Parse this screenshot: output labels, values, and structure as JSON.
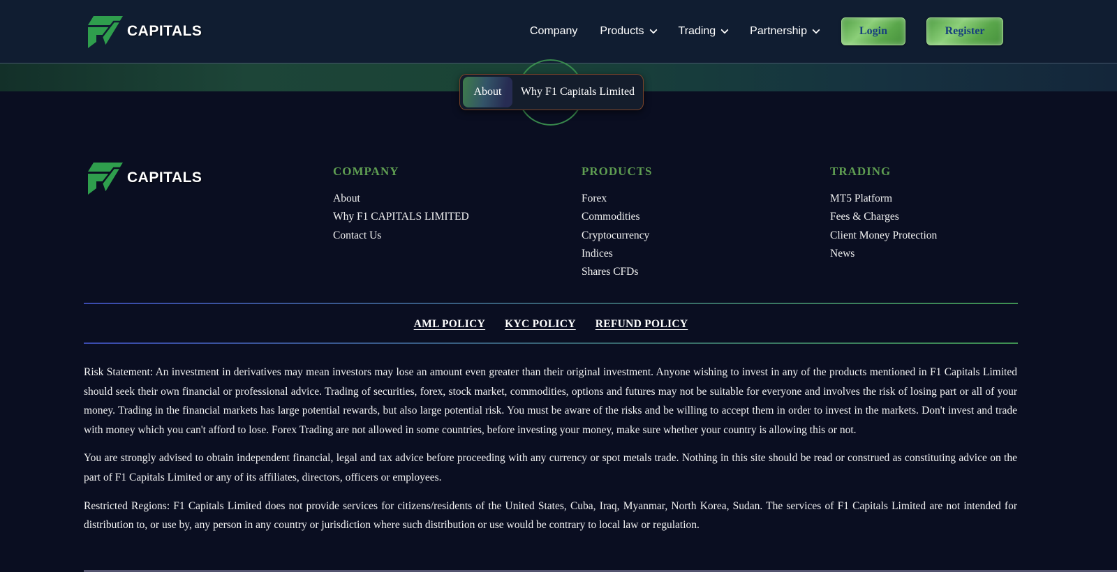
{
  "brand": {
    "name": "CAPITALS"
  },
  "header": {
    "nav": [
      {
        "label": "Company",
        "has_dropdown": false
      },
      {
        "label": "Products",
        "has_dropdown": true
      },
      {
        "label": "Trading",
        "has_dropdown": true
      },
      {
        "label": "Partnership",
        "has_dropdown": true
      }
    ],
    "login_label": "Login",
    "register_label": "Register"
  },
  "tabs": {
    "active": "About",
    "secondary": "Why F1 Capitals Limited"
  },
  "footer": {
    "columns": [
      {
        "title": "COMPANY",
        "links": [
          "About",
          "Why F1 CAPITALS LIMITED",
          "Contact Us"
        ]
      },
      {
        "title": "PRODUCTS",
        "links": [
          "Forex",
          "Commodities",
          "Cryptocurrency",
          "Indices",
          "Shares CFDs"
        ]
      },
      {
        "title": "TRADING",
        "links": [
          "MT5 Platform",
          "Fees & Charges",
          "Client Money Protection",
          "News"
        ]
      }
    ],
    "policies": [
      "AML POLICY",
      "KYC POLICY",
      "REFUND POLICY"
    ],
    "paragraphs": [
      "Risk Statement: An investment in derivatives may mean investors may lose an amount even greater than their original investment. Anyone wishing to invest in any of the products mentioned in F1 Capitals Limited should seek their own financial or professional advice. Trading of securities, forex, stock market, commodities, options and futures may not be suitable for everyone and involves the risk of losing part or all of your money. Trading in the financial markets has large potential rewards, but also large potential risk. You must be aware of the risks and be willing to accept them in order to invest in the markets. Don't invest and trade with money which you can't afford to lose. Forex Trading are not allowed in some countries, before investing your money, make sure whether your country is allowing this or not.",
      "You are strongly advised to obtain independent financial, legal and tax advice before proceeding with any currency or spot metals trade. Nothing in this site should be read or construed as constituting advice on the part of F1 Capitals Limited or any of its affiliates, directors, officers or employees.",
      "Restricted Regions: F1 Capitals Limited does not provide services for citizens/residents of the United States, Cuba, Iraq, Myanmar, North Korea, Sudan. The services of F1 Capitals Limited are not intended for distribution to, or use by, any person in any country or jurisdiction where such distribution or use would be contrary to local law or regulation."
    ]
  },
  "colors": {
    "brand_green": "#2f9e4d",
    "heading_green": "#5f9e52",
    "header_bg": "#101d31",
    "page_bg": "#0a0e21",
    "button_text": "#173f7d",
    "band_teal": "#1d4538",
    "divider_blue": "#3b4bb0",
    "divider_green": "#3f9152"
  }
}
